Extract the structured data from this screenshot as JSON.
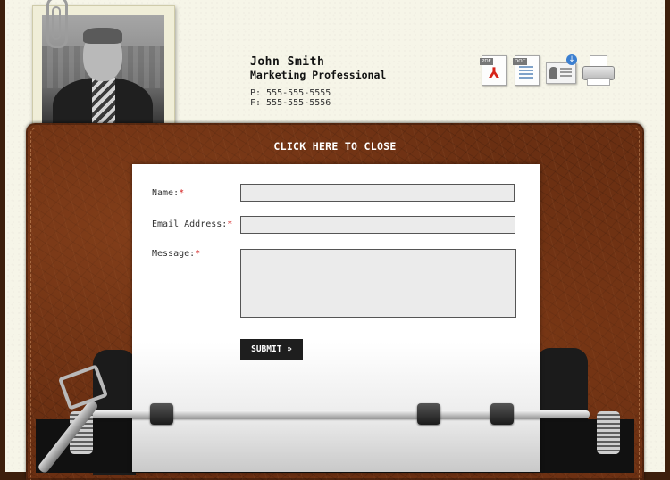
{
  "profile": {
    "name": "John Smith",
    "title": "Marketing Professional",
    "phone": "P: 555-555-5555",
    "fax": "F: 555-555-5556"
  },
  "icons": {
    "pdf_tag": "PDF",
    "doc_tag": "DOC",
    "pdf_mark": "⅄"
  },
  "modal": {
    "close_label": "CLICK HERE TO CLOSE"
  },
  "form": {
    "name_label": "Name:",
    "email_label": "Email Address:",
    "message_label": "Message:",
    "required_mark": "*",
    "name_value": "",
    "email_value": "",
    "message_value": "",
    "submit_label": "SUBMIT »"
  },
  "colors": {
    "required": "#d31a1a",
    "leather": "#6a2f12",
    "button_bg": "#1e1e1e"
  }
}
